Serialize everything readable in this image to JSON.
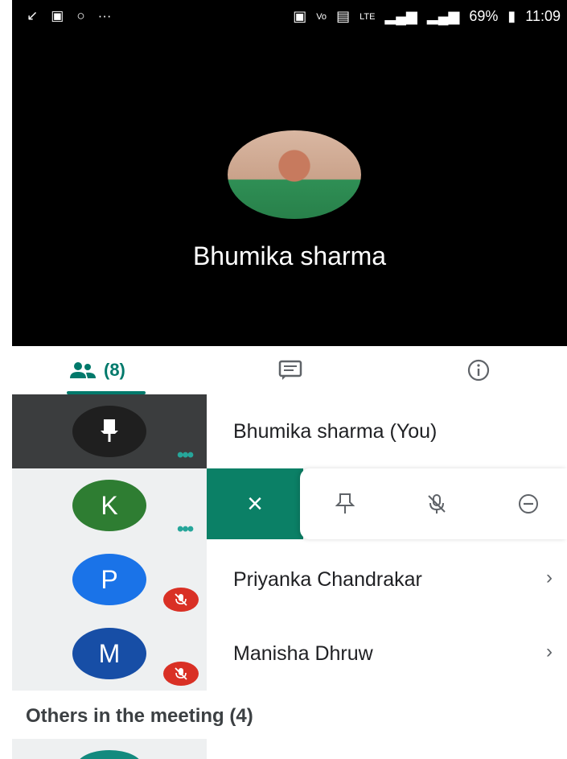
{
  "status_bar": {
    "left_icons": [
      "missed-call-icon",
      "image-icon",
      "whatsapp-icon",
      "more-icon"
    ],
    "more": "···",
    "right_icons": [
      "alarm-icon",
      "volte-icon",
      "sim-icon",
      "lte-icon",
      "signal-icon",
      "signal-icon",
      "battery-icon"
    ],
    "battery": "69%",
    "time": "11:09"
  },
  "video": {
    "speaker_name": "Bhumika sharma"
  },
  "tabs": {
    "people_count": "(8)",
    "items": [
      "people-tab",
      "chat-tab",
      "info-tab"
    ]
  },
  "participants": [
    {
      "name": "Bhumika sharma (You)",
      "initial": "",
      "avatar_color": "#1f1f1f",
      "pinned": true,
      "muted": false
    },
    {
      "name": "",
      "initial": "K",
      "avatar_color": "#2e7d32",
      "pinned": false,
      "muted": false,
      "actions_open": true
    },
    {
      "name": "Priyanka Chandrakar",
      "initial": "P",
      "avatar_color": "#1a73e8",
      "pinned": false,
      "muted": true
    },
    {
      "name": "Manisha Dhruw",
      "initial": "M",
      "avatar_color": "#174ea6",
      "pinned": false,
      "muted": true
    }
  ],
  "actions": {
    "close": "×",
    "icons": [
      "pin-icon",
      "mute-icon",
      "remove-icon"
    ]
  },
  "others": {
    "title": "Others in the meeting (4)"
  },
  "colors": {
    "accent": "#00796b",
    "muted_red": "#d93025"
  }
}
